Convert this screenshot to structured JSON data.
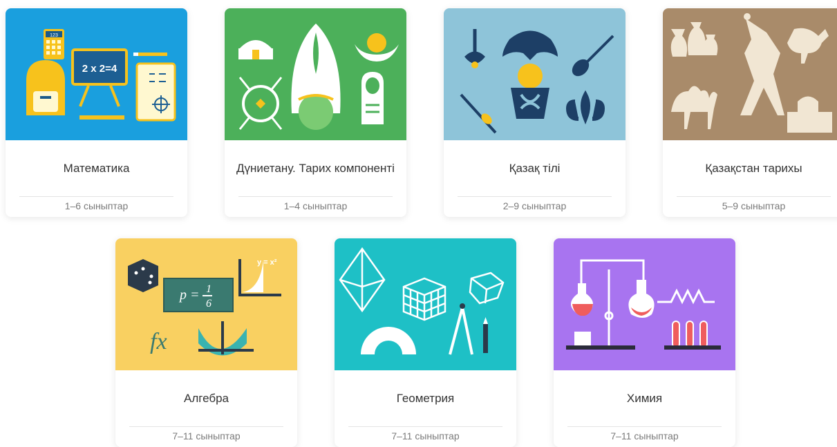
{
  "subjects": [
    {
      "title": "Математика",
      "grades": "1–6 сыныптар",
      "color": "#1a9fde",
      "icon": "math-illustration"
    },
    {
      "title": "Дүниетану. Тарих компоненті",
      "grades": "1–4 сыныптар",
      "color": "#4cb05a",
      "icon": "history-world-illustration"
    },
    {
      "title": "Қазақ тілі",
      "grades": "2–9 сыныптар",
      "color": "#8ec4d9",
      "icon": "kazakh-language-illustration"
    },
    {
      "title": "Қазақстан тарихы",
      "grades": "5–9 сыныптар",
      "color": "#a98b6a",
      "icon": "kazakhstan-history-illustration"
    },
    {
      "title": "Алгебра",
      "grades": "7–11 сыныптар",
      "color": "#f9d061",
      "icon": "algebra-illustration"
    },
    {
      "title": "Геометрия",
      "grades": "7–11 сыныптар",
      "color": "#1ec0c6",
      "icon": "geometry-illustration"
    },
    {
      "title": "Химия",
      "grades": "7–11 сыныптар",
      "color": "#a874f0",
      "icon": "chemistry-illustration"
    }
  ],
  "illustration_text": {
    "calculator": "123",
    "board": "2 x 2=4",
    "probability_p": "p =",
    "probability_num": "1",
    "probability_den": "6",
    "fx": "fx",
    "parabola": "y = x²"
  }
}
